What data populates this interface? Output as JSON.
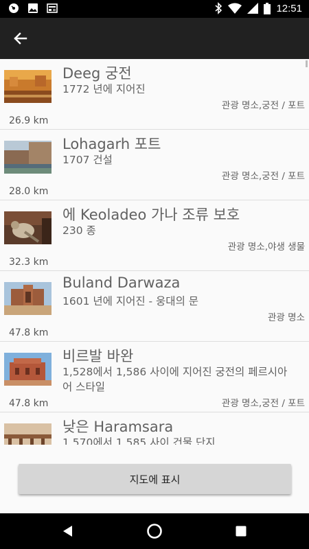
{
  "status_bar": {
    "time": "12:51",
    "left_icons": [
      "vinyl-record-icon",
      "image-icon",
      "news-icon"
    ],
    "right_icons": [
      "bluetooth-icon",
      "wifi-icon",
      "signal-icon",
      "battery-icon"
    ]
  },
  "app_bar": {
    "back_icon": "arrow-back-icon"
  },
  "places": [
    {
      "title": "Deeg 궁전",
      "description": "1772 년에 지어진",
      "category": "관광 명소,궁전 / 포트",
      "distance": "26.9 km"
    },
    {
      "title": "Lohagarh 포트",
      "description": "1707 건설",
      "category": "관광 명소,궁전 / 포트",
      "distance": "28.0 km"
    },
    {
      "title": "에 Keoladeo 가나 조류 보호",
      "description": "230 종",
      "category": "관광 명소,야생 생물",
      "distance": "32.3 km"
    },
    {
      "title": "Buland Darwaza",
      "description": "1601 년에 지어진 - 웅대의 문",
      "category": "관광 명소",
      "distance": "47.8 km"
    },
    {
      "title": "비르발 바완",
      "description": "1,528에서 1,586 사이에 지어진 궁전의 페르시아어 스타일",
      "category": "관광 명소,궁전 / 포트",
      "distance": "47.8 km"
    },
    {
      "title": "낮은 Haramsara",
      "description": "1,570에서 1,585 사이 건물 단지",
      "category": "",
      "distance": ""
    }
  ],
  "show_on_map_label": "지도에 표시",
  "nav_bar": {
    "icons": [
      "back-triangle-icon",
      "home-circle-icon",
      "recents-square-icon"
    ]
  }
}
